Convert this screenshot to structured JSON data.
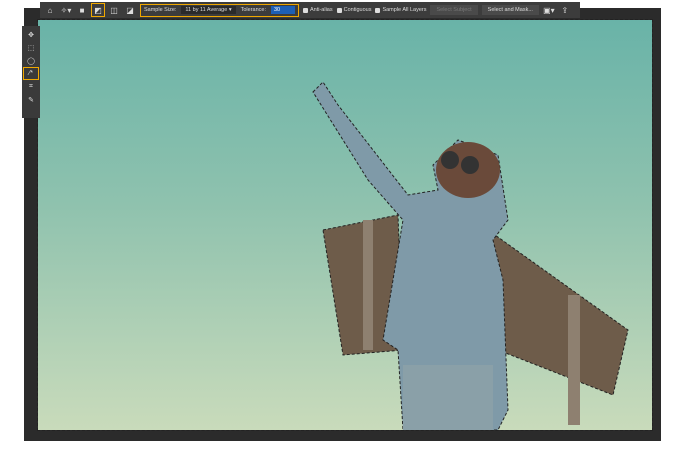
{
  "toolbar": {
    "sample_size_label": "Sample Size:",
    "sample_size_value": "11 by 11 Average",
    "tolerance_label": "Tolerance:",
    "tolerance_value": "30",
    "anti_alias": "Anti-alias",
    "contiguous": "Contiguous",
    "sample_all_layers": "Sample All Layers",
    "select_subject": "Select Subject",
    "select_and_mask": "Select and Mask..."
  },
  "tools": [
    "move",
    "marquee",
    "lasso",
    "magic-wand",
    "crop",
    "eyedropper"
  ],
  "colors": {
    "accent": "#f0a800",
    "panel": "#3c3c3c",
    "selection": "#1d5fb5"
  }
}
